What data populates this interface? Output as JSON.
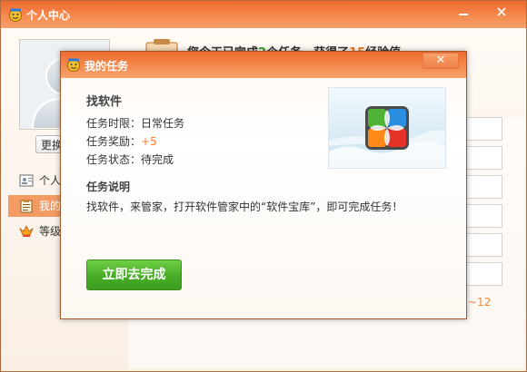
{
  "main_window": {
    "title": "个人中心",
    "change_avatar_label": "更换",
    "sidebar": [
      {
        "label": "个人",
        "icon": "profile-card-icon"
      },
      {
        "label": "我的",
        "icon": "clipboard-icon"
      },
      {
        "label": "等级",
        "icon": "crown-icon"
      }
    ],
    "header_text_parts": [
      "您今天已完成",
      "2",
      "个任务，获得了",
      "15",
      "经验值"
    ],
    "range_text": "~12"
  },
  "modal": {
    "title": "我的任务",
    "close_glyph": "✕",
    "task_name": "找软件",
    "rows": [
      {
        "label": "任务时限：",
        "value": "日常任务"
      },
      {
        "label": "任务奖励：",
        "value": "+5"
      },
      {
        "label": "任务状态：",
        "value": "待完成"
      }
    ],
    "section_title": "任务说明",
    "description": "找软件，来管家，打开软件管家中的“软件宝库”，即可完成任务！",
    "button_label": "立即去完成"
  },
  "colors": {
    "title_bar": "#ee6a2f",
    "accent_orange": "#ff7d27",
    "button_green": "#4aae29"
  }
}
